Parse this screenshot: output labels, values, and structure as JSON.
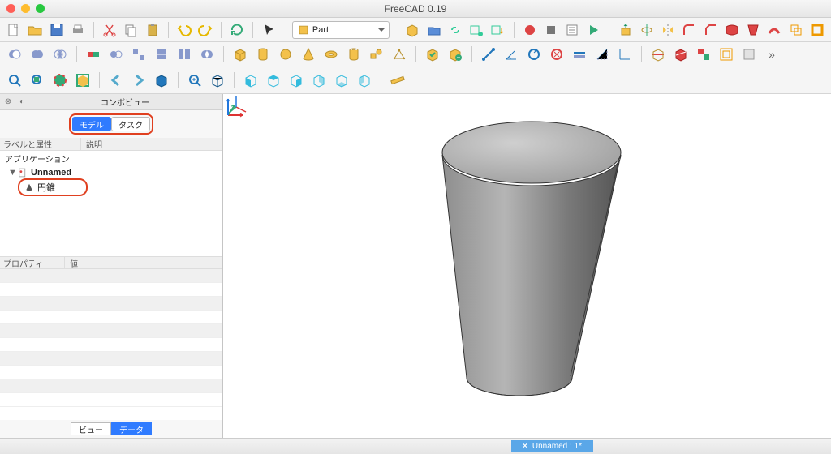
{
  "window": {
    "title": "FreeCAD 0.19"
  },
  "workbench": {
    "selected": "Part"
  },
  "combo_view": {
    "title": "コンボビュー",
    "tabs": {
      "model": "モデル",
      "task": "タスク"
    },
    "tree_headers": {
      "label": "ラベルと属性",
      "desc": "説明"
    },
    "tree": {
      "app": "アプリケーション",
      "doc": "Unnamed",
      "object": "円錐"
    },
    "prop_headers": {
      "prop": "プロパティ",
      "value": "値"
    },
    "bottom_tabs": {
      "view": "ビュー",
      "data": "データ"
    }
  },
  "status": {
    "doc": "Unnamed : 1*"
  },
  "icons": {
    "row1": [
      "new",
      "open",
      "save",
      "print",
      "cut",
      "copy",
      "paste-list",
      "paste",
      "undo",
      "redo",
      "refresh",
      "arrow",
      "wb",
      "whatsthis",
      "macro1",
      "macro2",
      "macro3",
      "macro4",
      "macro5",
      "macro6",
      "sheet1",
      "sheet2",
      "extrude",
      "revolve",
      "mirror",
      "fillet",
      "chamfer",
      "loft",
      "sweep",
      "draft1",
      "draft2"
    ],
    "row2": [
      "cube",
      "cylinder",
      "sphere",
      "cone",
      "torus",
      "prism",
      "plane",
      "ellipsoid",
      "box2",
      "cyl2",
      "sph2",
      "cone2",
      "tor2",
      "tube",
      "wedge",
      "helix",
      "spiral",
      "circle",
      "ellipse",
      "point",
      "line",
      "regpoly",
      "bool-cut",
      "bool-fuse",
      "bool-common",
      "section",
      "cross",
      "compound",
      "offset",
      "thickness",
      "more"
    ],
    "row3": [
      "measure",
      "zoom",
      "boundbox",
      "fitall",
      "nav-left",
      "nav-right",
      "viewcube",
      "zoom2",
      "iso",
      "front",
      "top",
      "right",
      "rear",
      "bottom",
      "left",
      "ruler"
    ]
  }
}
